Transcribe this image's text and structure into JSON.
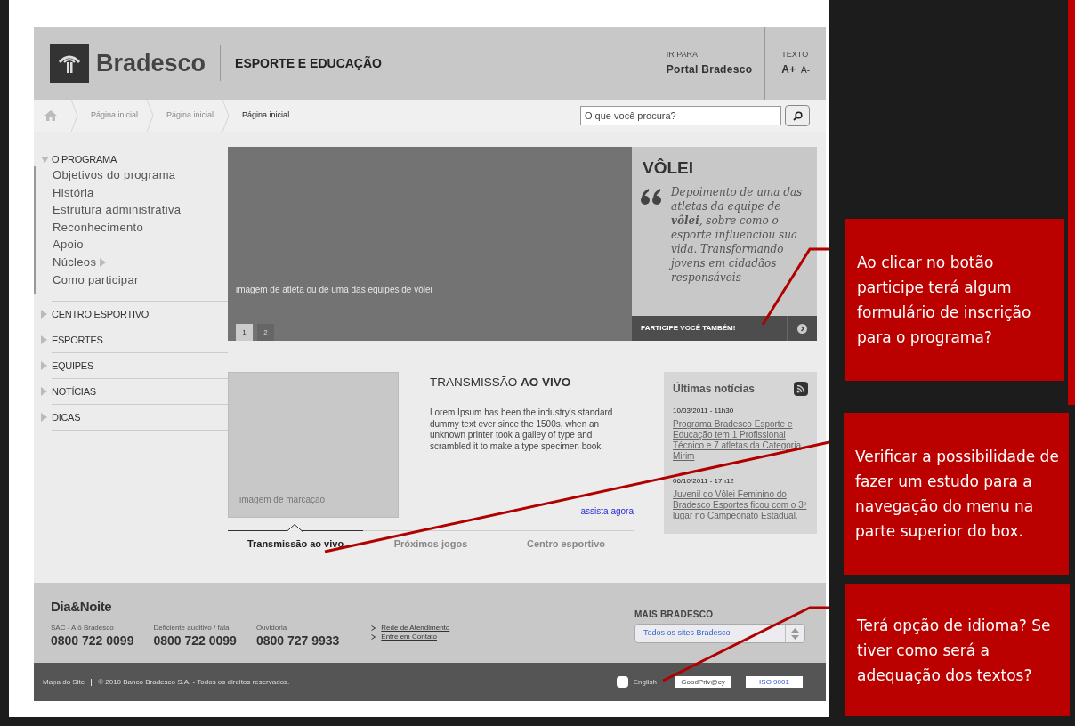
{
  "header": {
    "logo": "Bradesco",
    "section": "ESPORTE E EDUCAÇÃO",
    "goto_label": "IR PARA",
    "goto_link": "Portal Bradesco",
    "text_label": "TEXTO",
    "text_bigger": "A+",
    "text_smaller": "A-"
  },
  "breadcrumb": [
    "Página inicial",
    "Página inicial",
    "Página inicial"
  ],
  "search": {
    "placeholder": "O que você procura?"
  },
  "sidebar": [
    {
      "label": "O PROGRAMA",
      "expanded": true,
      "children": [
        {
          "label": "Objetivos do programa",
          "submenu": false
        },
        {
          "label": "História",
          "submenu": false
        },
        {
          "label": "Estrutura administrativa",
          "submenu": false
        },
        {
          "label": "Reconhecimento",
          "submenu": false
        },
        {
          "label": "Apoio",
          "submenu": false
        },
        {
          "label": "Núcleos",
          "submenu": true
        },
        {
          "label": "Como participar",
          "submenu": false
        }
      ]
    },
    {
      "label": "CENTRO ESPORTIVO",
      "expanded": false
    },
    {
      "label": "ESPORTES",
      "expanded": false
    },
    {
      "label": "EQUIPES",
      "expanded": false
    },
    {
      "label": "NOTÍCIAS",
      "expanded": false
    },
    {
      "label": "DICAS",
      "expanded": false
    }
  ],
  "hero": {
    "caption": "imagem de atleta ou de uma das equipes de vôlei",
    "pages": [
      {
        "label": "1",
        "selected": true
      },
      {
        "label": "2",
        "selected": false
      }
    ],
    "title": "VÔLEI",
    "quote": "Depoimento de uma das atletas da equipe de **vôlei**, sobre como o esporte influenciou sua vida. Transformando jovens em cidadãos responsáveis",
    "button": "PARTICIPE VOCÊ TAMBÉM!"
  },
  "live": {
    "image_caption": "imagem de marcação",
    "title": "TRANSMISSÃO **AO VIVO**",
    "text": "Lorem Ipsum has been the industry's standard dummy text ever since the 1500s, when an unknown printer took a galley of type and scrambled it to make a type specimen book.",
    "link": "assista agora"
  },
  "tabs": [
    {
      "label": "Transmissão ao vivo",
      "selected": true
    },
    {
      "label": "Próximos jogos",
      "selected": false
    },
    {
      "label": "Centro esportivo",
      "selected": false
    }
  ],
  "news": {
    "title": "Últimas notícias",
    "items": [
      {
        "date": "10/03/2011 - 11h30",
        "headline": "Programa Bradesco Esporte e Educação tem 1 Profissional Técnico e 7 atletas da Categoria Mirim"
      },
      {
        "date": "06/10/2011 - 17h12",
        "headline": "Juvenil do Vôlei Feminino do Bradesco Esportes ficou com o 3º lugar no Campeonato Estadual."
      }
    ]
  },
  "footer": {
    "brand": "Dia&Noite",
    "contacts": [
      {
        "label": "SAC - Alô Bradesco",
        "number": "0800 722 0099"
      },
      {
        "label": "Deficiente auditivo / fala",
        "number": "0800 722 0099"
      },
      {
        "label": "Ouvidoria",
        "number": "0800 727 9933"
      }
    ],
    "links": [
      "Rede de Atendimento",
      "Entre em Contato"
    ],
    "more_title": "MAIS BRADESCO",
    "select_value": "Todos os sites Bradesco",
    "sitemap": "Mapa do Site",
    "copyright": "© 2010 Banco Bradesco S.A. - Todos os direitos reservados.",
    "english": {
      "label": "English",
      "checked": false
    },
    "badges": [
      "GoodPriv@cy",
      "ISO 9001"
    ]
  },
  "annotations": [
    "Ao clicar no botão participe terá algum formulário de inscrição para o programa?",
    "Verificar a possibilidade de fazer um estudo para a navegação do menu na parte superior do box.",
    "Terá opção de idioma? Se tiver como será a adequação dos textos?"
  ]
}
